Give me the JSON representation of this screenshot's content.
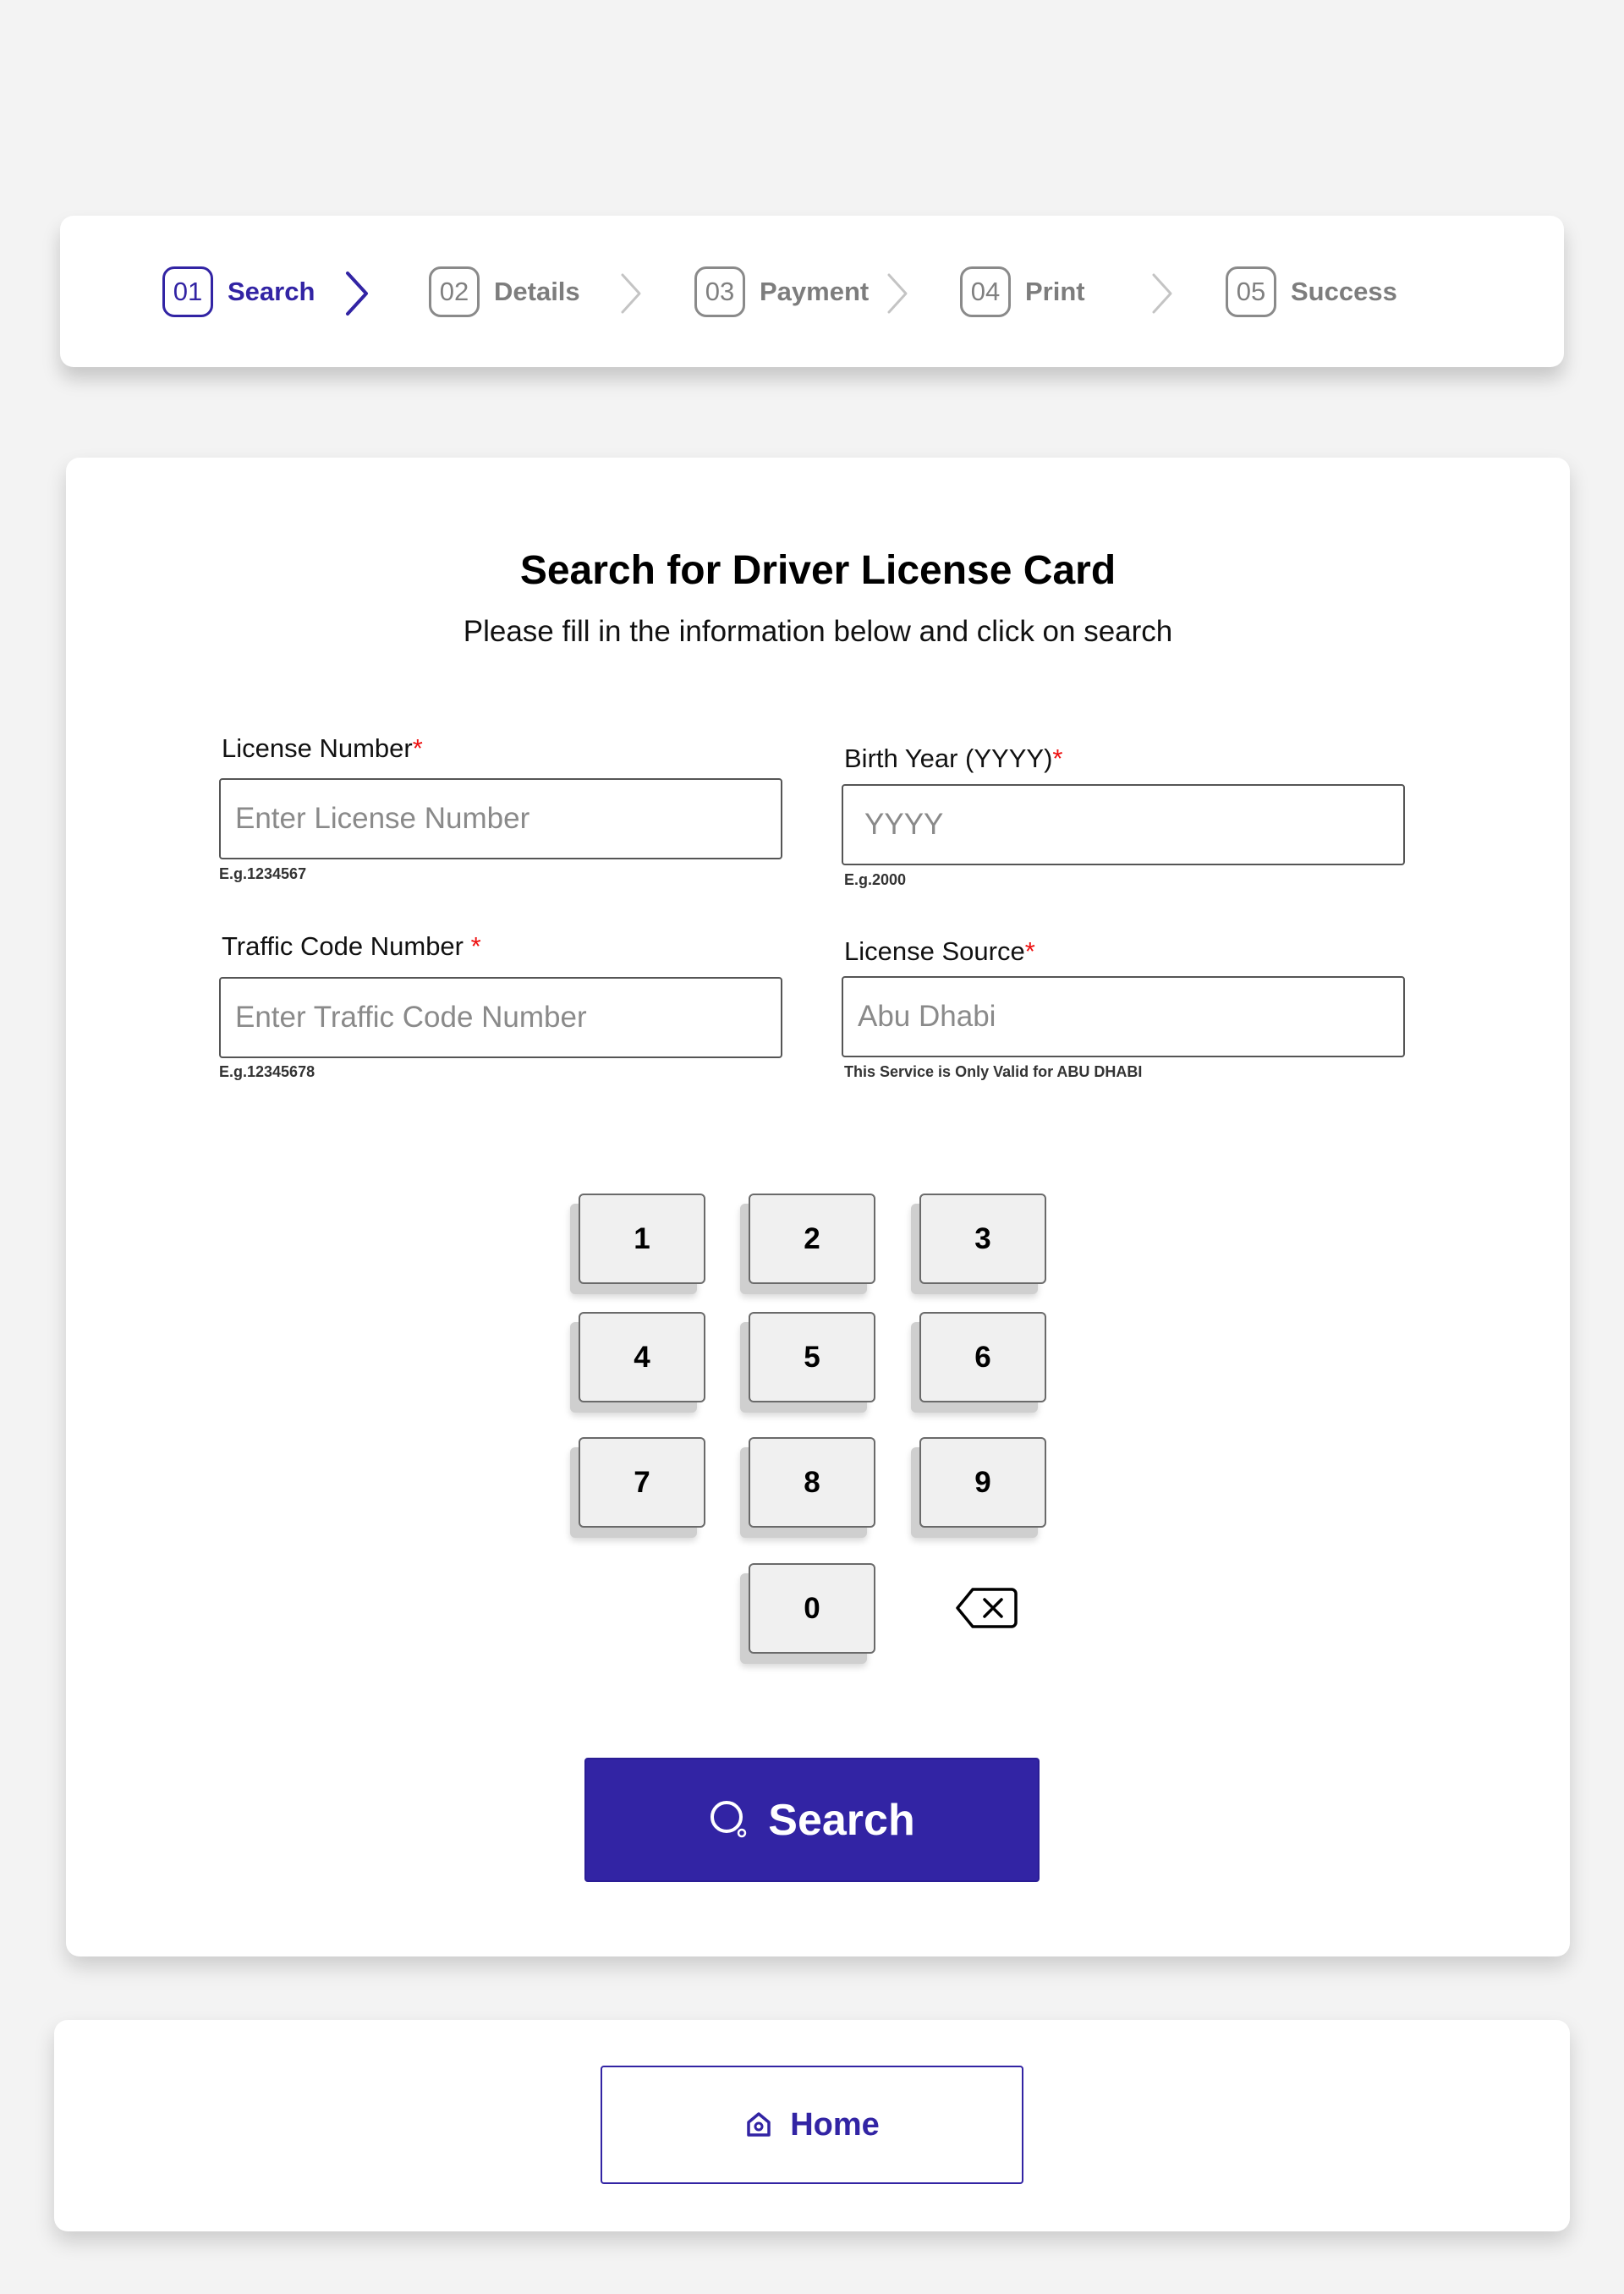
{
  "stepper": {
    "steps": [
      {
        "number": "01",
        "label": "Search",
        "state": "active"
      },
      {
        "number": "02",
        "label": "Details",
        "state": "inactive"
      },
      {
        "number": "03",
        "label": "Payment",
        "state": "inactive"
      },
      {
        "number": "04",
        "label": "Print",
        "state": "inactive"
      },
      {
        "number": "05",
        "label": "Success",
        "state": "inactive"
      }
    ],
    "chevron_icon": "chevron-right-icon"
  },
  "form": {
    "title": "Search for Driver License Card",
    "subtitle": "Please fill in the information below and click on search",
    "required_mark": "*",
    "license_number": {
      "label": "License Number",
      "placeholder": "Enter License Number",
      "value": "",
      "hint": "E.g.1234567"
    },
    "birth_year": {
      "label": "Birth Year (YYYY)",
      "placeholder": "YYYY",
      "value": "",
      "hint": "E.g.2000"
    },
    "traffic_code": {
      "label": "Traffic Code Number ",
      "placeholder": "Enter Traffic Code Number",
      "value": "",
      "hint": "E.g.12345678"
    },
    "license_source": {
      "label": "License Source",
      "placeholder": "Abu Dhabi",
      "value": "",
      "hint": "This Service is Only Valid for ABU DHABI"
    }
  },
  "keypad": {
    "keys": [
      "1",
      "2",
      "3",
      "4",
      "5",
      "6",
      "7",
      "8",
      "9",
      "0"
    ],
    "backspace_icon": "backspace-icon"
  },
  "search_button": {
    "label": "Search",
    "icon": "search-icon"
  },
  "footer": {
    "home_button": {
      "label": "Home",
      "icon": "home-icon"
    }
  },
  "colors": {
    "accent": "#3224a4",
    "inactive": "#7d7d7d",
    "required": "#e11111",
    "background": "#f3f3f3"
  }
}
